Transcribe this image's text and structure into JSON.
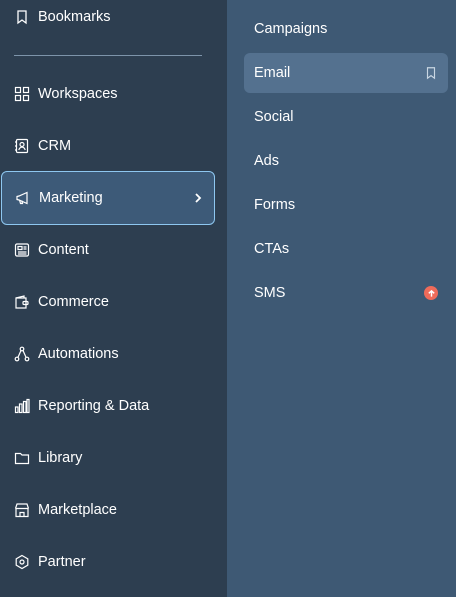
{
  "sidebar": {
    "bookmarks": {
      "label": "Bookmarks",
      "icon": "bookmark-icon"
    },
    "items": [
      {
        "label": "Workspaces",
        "icon": "grid-icon"
      },
      {
        "label": "CRM",
        "icon": "contacts-icon"
      },
      {
        "label": "Marketing",
        "icon": "megaphone-icon",
        "active": true
      },
      {
        "label": "Content",
        "icon": "content-icon"
      },
      {
        "label": "Commerce",
        "icon": "wallet-icon"
      },
      {
        "label": "Automations",
        "icon": "automation-icon"
      },
      {
        "label": "Reporting & Data",
        "icon": "bar-chart-icon"
      },
      {
        "label": "Library",
        "icon": "folder-icon"
      },
      {
        "label": "Marketplace",
        "icon": "storefront-icon"
      },
      {
        "label": "Partner",
        "icon": "partner-icon"
      }
    ]
  },
  "flyout": {
    "items": [
      {
        "label": "Campaigns"
      },
      {
        "label": "Email",
        "highlight": true,
        "trail": "bookmark-icon"
      },
      {
        "label": "Social"
      },
      {
        "label": "Ads"
      },
      {
        "label": "Forms"
      },
      {
        "label": "CTAs"
      },
      {
        "label": "SMS",
        "trail": "upgrade-icon"
      }
    ]
  },
  "colors": {
    "sidebar_bg": "#2d3e50",
    "flyout_bg": "#3e5974",
    "active_bg": "#3d5a78",
    "active_border": "#8ec7f0",
    "highlight_bg": "#54718f",
    "upgrade_badge": "#ef6b5a"
  }
}
